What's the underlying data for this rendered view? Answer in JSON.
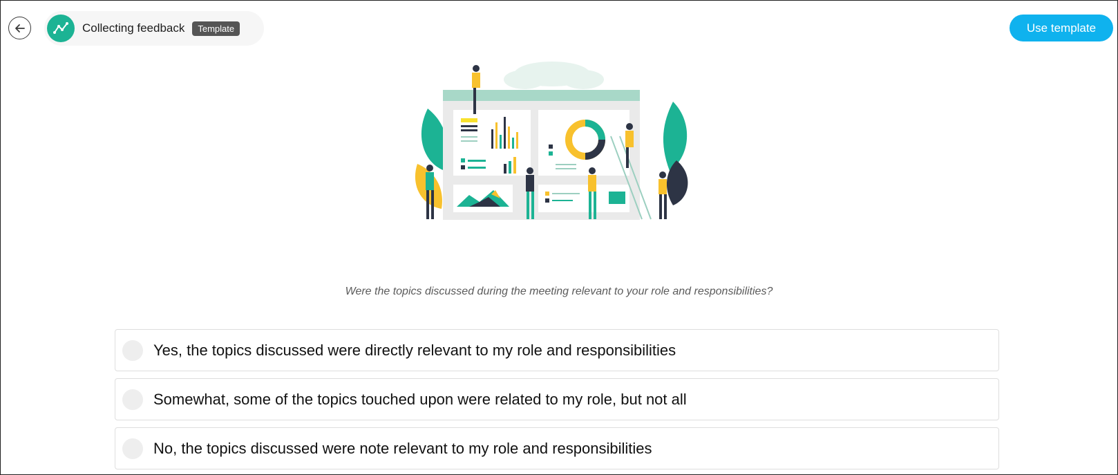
{
  "header": {
    "title": "Collecting feedback",
    "badge": "Template",
    "use_button": "Use template",
    "back_icon": "arrow-left-icon",
    "title_icon": "trend-line-icon"
  },
  "colors": {
    "accent": "#1cb394",
    "primary_button": "#0fb2ee",
    "badge_bg": "#555555"
  },
  "question": "Were the topics discussed during the meeting relevant to your role and responsibilities?",
  "options": [
    {
      "label": "Yes, the topics discussed were directly relevant to my role and responsibilities"
    },
    {
      "label": "Somewhat, some of the topics touched upon were related to my role, but not all"
    },
    {
      "label": "No, the topics discussed were note relevant to my role and responsibilities"
    }
  ]
}
